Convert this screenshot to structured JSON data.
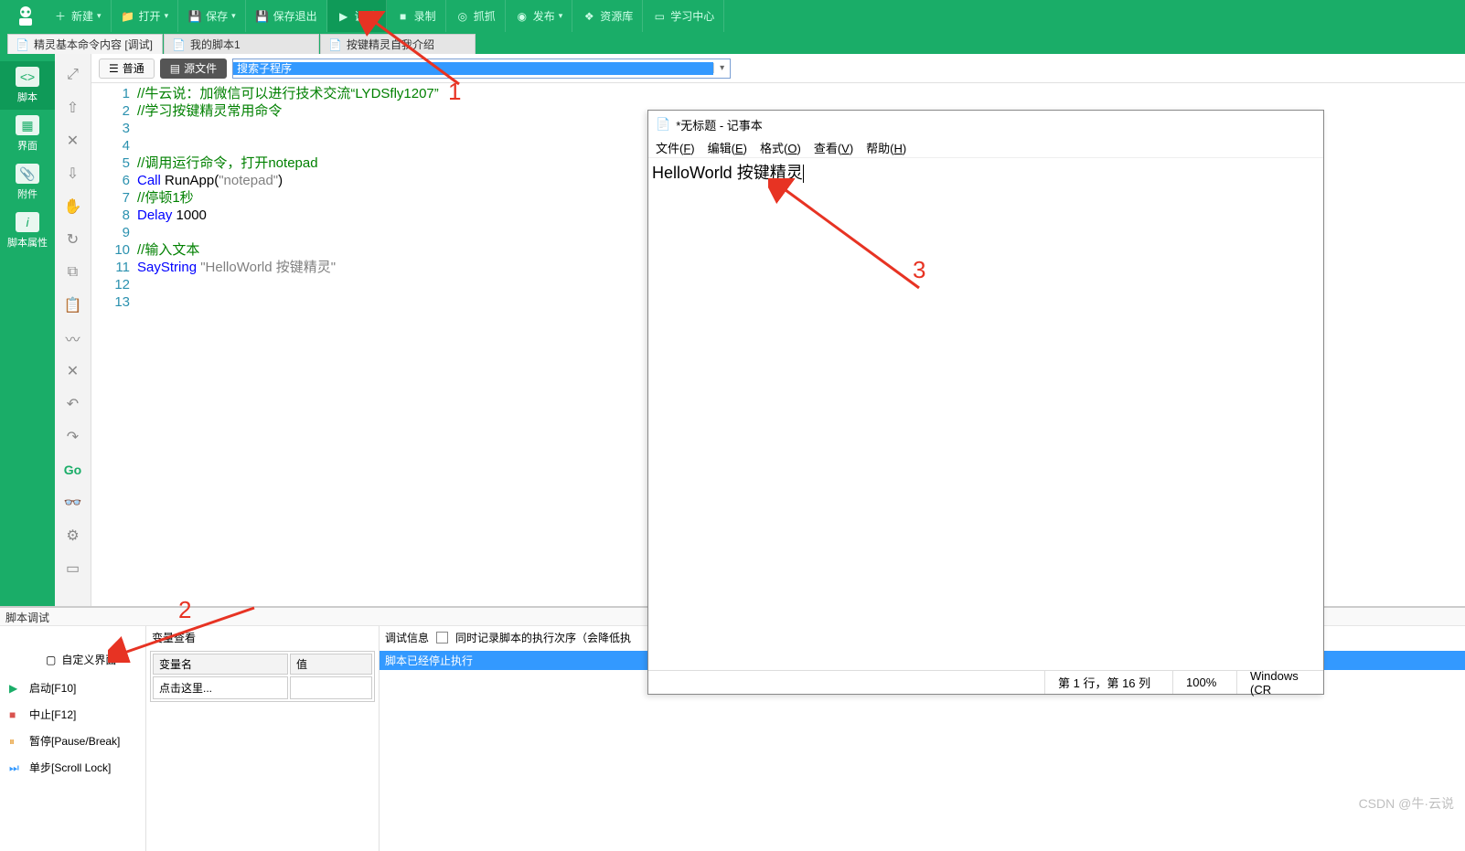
{
  "toolbar": {
    "new": "新建",
    "open": "打开",
    "save": "保存",
    "save_exit": "保存退出",
    "debug": "调试",
    "record": "录制",
    "grab": "抓抓",
    "publish": "发布",
    "resource": "资源库",
    "learn": "学习中心"
  },
  "tabs": [
    {
      "label": "精灵基本命令内容  [调试]"
    },
    {
      "label": "我的脚本1"
    },
    {
      "label": "按键精灵自我介绍"
    }
  ],
  "left_sidebar": [
    {
      "label": "脚本",
      "icon": "code"
    },
    {
      "label": "界面",
      "icon": "grid"
    },
    {
      "label": "附件",
      "icon": "attach"
    },
    {
      "label": "脚本属性",
      "icon": "info"
    }
  ],
  "editor_bar": {
    "normal": "普通",
    "source": "源文件",
    "search_value": "搜索子程序"
  },
  "code_lines": [
    {
      "n": 1,
      "seg": [
        {
          "t": "//牛云说：加微信可以进行技术交流“LYDSfly1207”",
          "c": "c-comment"
        }
      ]
    },
    {
      "n": 2,
      "seg": [
        {
          "t": "//学习按键精灵常用命令",
          "c": "c-comment"
        }
      ]
    },
    {
      "n": 3,
      "seg": []
    },
    {
      "n": 4,
      "seg": []
    },
    {
      "n": 5,
      "seg": [
        {
          "t": "//调用运行命令，打开notepad",
          "c": "c-comment"
        }
      ]
    },
    {
      "n": 6,
      "seg": [
        {
          "t": "Call ",
          "c": "c-keyword"
        },
        {
          "t": "RunApp",
          "c": "c-func"
        },
        {
          "t": "(",
          "c": ""
        },
        {
          "t": "\"notepad\"",
          "c": "c-string"
        },
        {
          "t": ")",
          "c": ""
        }
      ]
    },
    {
      "n": 7,
      "seg": [
        {
          "t": "//停顿1秒",
          "c": "c-comment"
        }
      ]
    },
    {
      "n": 8,
      "seg": [
        {
          "t": "Delay ",
          "c": "c-keyword"
        },
        {
          "t": "1000",
          "c": "c-num"
        }
      ]
    },
    {
      "n": 9,
      "seg": []
    },
    {
      "n": 10,
      "seg": [
        {
          "t": "//输入文本",
          "c": "c-comment"
        }
      ]
    },
    {
      "n": 11,
      "seg": [
        {
          "t": "SayString ",
          "c": "c-keyword"
        },
        {
          "t": "\"HelloWorld 按键精灵\"",
          "c": "c-string"
        }
      ]
    },
    {
      "n": 12,
      "seg": []
    },
    {
      "n": 13,
      "seg": []
    }
  ],
  "bottom": {
    "title": "脚本调试",
    "custom_ui": "自定义界面",
    "cmds": {
      "start": "启动[F10]",
      "stop": "中止[F12]",
      "pause": "暂停[Pause/Break]",
      "step": "单步[Scroll Lock]"
    },
    "var_title": "变量查看",
    "var_col_name": "变量名",
    "var_col_val": "值",
    "var_placeholder": "点击这里...",
    "dbg_title": "调试信息",
    "dbg_chk_label": "同时记录脚本的执行次序（会降低执",
    "dbg_message": "脚本已经停止执行"
  },
  "notepad": {
    "title": "*无标题 - 记事本",
    "menu": {
      "file": "文件(F)",
      "edit": "编辑(E)",
      "format": "格式(O)",
      "view": "查看(V)",
      "help": "帮助(H)"
    },
    "content": "HelloWorld 按键精灵",
    "status": {
      "pos": "第 1 行，第 16 列",
      "zoom": "100%",
      "encoding": "Windows (CR"
    }
  },
  "annotations": {
    "n1": "1",
    "n2": "2",
    "n3": "3"
  },
  "watermark": "CSDN @牛·云说"
}
